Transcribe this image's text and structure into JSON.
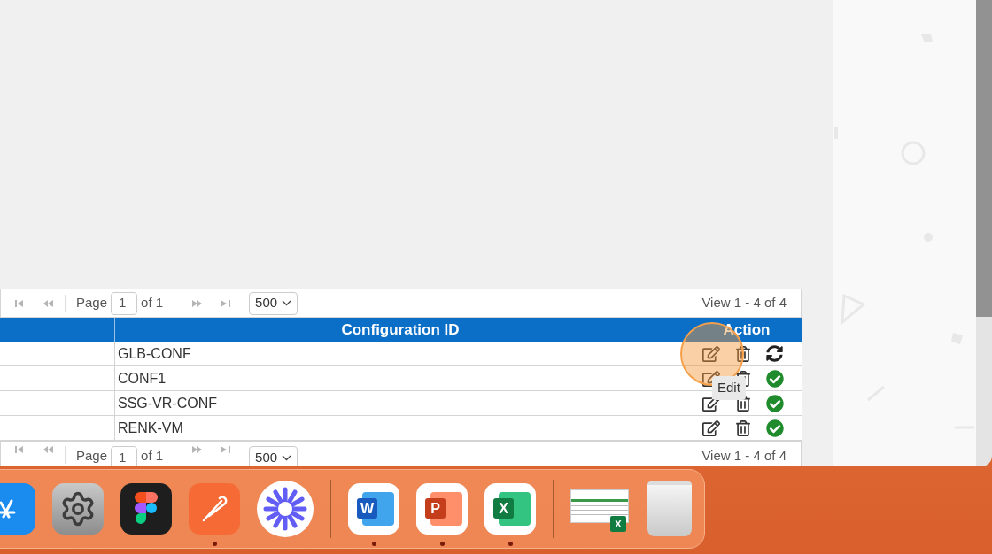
{
  "pager_top": {
    "page_label": "Page",
    "page": "1",
    "of": "of 1",
    "page_size": "500",
    "view": "View 1 - 4 of 4"
  },
  "table": {
    "columns": [
      {
        "label": "Configuration ID"
      },
      {
        "label": "Action"
      }
    ],
    "rows": [
      {
        "config_id": "GLB-CONF",
        "kind": "refresh"
      },
      {
        "config_id": "CONF1",
        "kind": "ok"
      },
      {
        "config_id": "SSG-VR-CONF",
        "kind": "ok"
      },
      {
        "config_id": "RENK-VM",
        "kind": "ok"
      }
    ]
  },
  "pager_bottom": {
    "page_label": "Page",
    "page": "1",
    "of": "of 1",
    "page_size": "500",
    "view": "View 1 - 4 of 4"
  },
  "tooltip": {
    "text": "Edit"
  },
  "dock": [
    {
      "kind": "store",
      "running": false
    },
    {
      "kind": "settings",
      "running": false
    },
    {
      "kind": "figma",
      "running": false
    },
    {
      "kind": "postman",
      "running": true
    },
    {
      "kind": "asterisk",
      "running": false
    },
    {
      "kind": "separator"
    },
    {
      "kind": "word",
      "glyph": "W",
      "running": true
    },
    {
      "kind": "powerpoint",
      "glyph": "P",
      "running": true
    },
    {
      "kind": "excel",
      "glyph": "X",
      "running": true
    },
    {
      "kind": "separator"
    },
    {
      "kind": "file",
      "glyph": "X",
      "running": false
    },
    {
      "kind": "trash",
      "running": false
    }
  ]
}
